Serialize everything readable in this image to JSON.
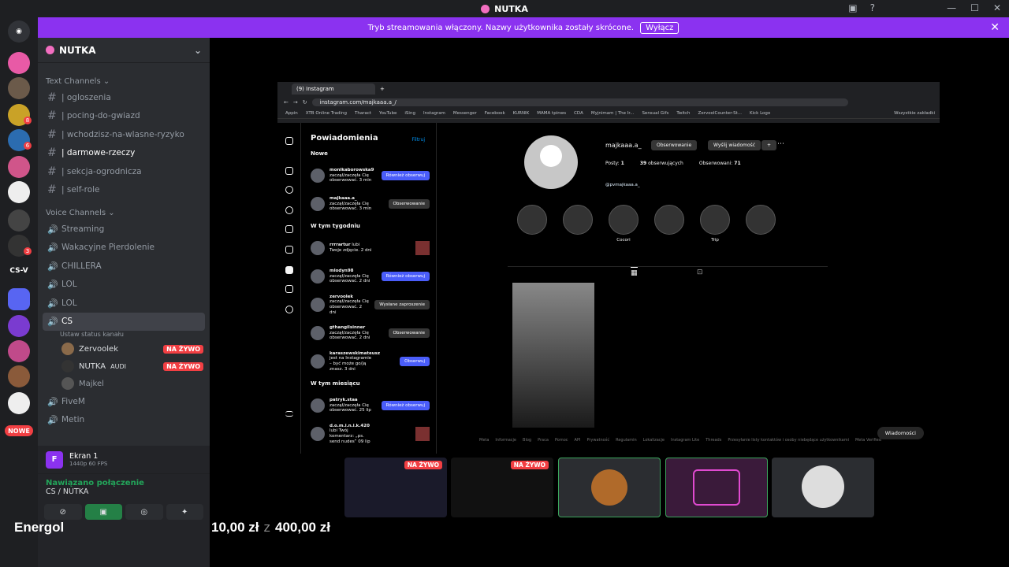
{
  "app": {
    "title": "NUTKA"
  },
  "banner": {
    "text": "Tryb streamowania włączony. Nazwy użytkownika zostały skrócone.",
    "button": "Wyłącz"
  },
  "rail": {
    "cs_label": "CS-V",
    "nowe": "NOWE",
    "badges": [
      "8",
      "6",
      "3"
    ]
  },
  "server": {
    "name": "NUTKA"
  },
  "text_channels": {
    "header": "Text Channels",
    "items": [
      {
        "label": "| ogloszenia"
      },
      {
        "label": "| pocing-do-gwiazd"
      },
      {
        "label": "| wchodzisz-na-wlasne-ryzyko"
      },
      {
        "label": "| darmowe-rzeczy"
      },
      {
        "label": "| sekcja-ogrodnicza"
      },
      {
        "label": "| self-role"
      }
    ]
  },
  "voice_channels": {
    "header": "Voice Channels",
    "items": [
      {
        "label": "Streaming"
      },
      {
        "label": "Wakacyjne Pierdolenie"
      },
      {
        "label": "CHILLERA"
      },
      {
        "label": "LOL"
      },
      {
        "label": "LOL"
      },
      {
        "label": "CS"
      }
    ]
  },
  "cs_status": "Ustaw status kanału",
  "voice_users": [
    {
      "name": "Zervoolek",
      "live": "NA ŻYWO"
    },
    {
      "name": "NUTKA",
      "extra": "AUDI",
      "live": "NA ŻYWO"
    },
    {
      "name": "Majkel"
    }
  ],
  "more_voice": [
    {
      "label": "FiveM"
    },
    {
      "label": "Metin"
    }
  ],
  "panel": {
    "screen_title": "Ekran 1",
    "screen_sub": "1440p 60 FPS",
    "conn_status": "Nawiązano połączenie",
    "conn_loc": "CS / NUTKA"
  },
  "browser": {
    "tab": "(9) Instagram",
    "url": "instagram.com/majkaaa.a_/",
    "bookmarks": [
      "Appin",
      "XTB Online Trading",
      "Tharact",
      "YouTube",
      "iSing",
      "Instagram",
      "Messenger",
      "Facebook",
      "KURNIK",
      "MAMA tpinws",
      "CDA",
      "Myjnimam | The Ir...",
      "Sensual Gifs",
      "Twitch",
      "ZervoolCounter-St...",
      "Kick Logo",
      "Wszystkie zakładki"
    ]
  },
  "notifications": {
    "title": "Powiadomienia",
    "filter": "Filtruj",
    "new": "Nowe",
    "week": "W tym tygodniu",
    "month": "W tym miesiącu",
    "rows": [
      {
        "user": "monikaborowska9",
        "text": "zaczął/zaczęła Cię obserwować. 3 min",
        "btn": "Również obserwuj",
        "type": "blue"
      },
      {
        "user": "majkaaa.a_",
        "text": "zaczął/zaczęła Cię obserwować. 3 min",
        "btn": "Obserwowanie",
        "type": "grey"
      },
      {
        "user": "rrrrartur",
        "text": "lubi Twoje zdjęcie. 2 dni",
        "type": "thumb"
      },
      {
        "user": "mlodyn98",
        "text": "zaczął/zaczęła Cię obserwować. 2 dni",
        "btn": "Również obserwuj",
        "type": "blue"
      },
      {
        "user": "zervoolek",
        "text": "zaczął/zaczęła Cię obserwować. 2 dni",
        "btn": "Wysłane zaproszenie",
        "type": "grey"
      },
      {
        "user": "gthangilsinner",
        "text": "zaczął/zaczęła Cię obserwować. 2 dni",
        "btn": "Obserwowanie",
        "type": "grey"
      },
      {
        "user": "karaszewskimateusz",
        "text": "jest na Instagramie – być może go/ją znasz. 3 dni",
        "btn": "Obserwuj",
        "type": "blue"
      },
      {
        "user": "patryk.staa",
        "text": "zaczął/zaczęła Cię obserwować. 25 lip",
        "btn": "Również obserwuj",
        "type": "blue"
      },
      {
        "user": "d.o.m.i.n.i.k.420",
        "text": "lubi Twój komentarz: „ps. send nudes” 09 lip",
        "type": "thumb"
      }
    ]
  },
  "profile": {
    "username": "majkaaa.a_",
    "follow_btn": "Obserwowanie",
    "msg_btn": "Wyślij wiadomość",
    "posts": "1",
    "posts_label": "Posty:",
    "followers": "39",
    "followers_label": "obserwujących",
    "following": "71",
    "following_label": "Obserwowani:",
    "link": "@pvmajkaaa.a_",
    "highlights": [
      "",
      "",
      "Cocori",
      "",
      "Trip",
      ""
    ],
    "footer": [
      "Meta",
      "Informacje",
      "Blog",
      "Praca",
      "Pomoc",
      "API",
      "Prywatność",
      "Regulamin",
      "Lokalizacje",
      "Instagram Lite",
      "Threads",
      "Przesyłanie listy kontaktów i osoby niebędące użytkownikami",
      "Meta Verified"
    ],
    "messages": "Wiadomości"
  },
  "streams": [
    {
      "live": "NA ŻYWO"
    },
    {
      "live": "NA ŻYWO"
    }
  ],
  "overlay": {
    "name": "Energol",
    "raised": "10,00 zł",
    "z": "z",
    "goal": "400,00 zł"
  },
  "colors": {
    "accent": "#8b32f0",
    "live": "#f23f43",
    "connected": "#23a55a"
  }
}
